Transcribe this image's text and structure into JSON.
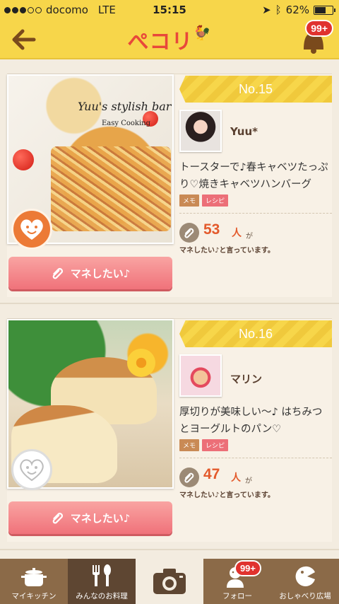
{
  "status_bar": {
    "carrier": "docomo",
    "network": "LTE",
    "time": "15:15",
    "battery": "62%",
    "battery_level": 0.62
  },
  "header": {
    "logo_text": "ぺコリ",
    "notification_badge": "99+"
  },
  "cards": [
    {
      "rank": "No.15",
      "photo_title": "Yuu's stylish bar",
      "photo_subtitle": "Easy Cooking",
      "username": "Yuu*",
      "title": "トースターで♪春キャベツたっぷり♡焼きキャベツハンバーグ",
      "tags": [
        "メモ",
        "レシピ"
      ],
      "like_count": "53",
      "like_unit": "人",
      "like_ga": "が",
      "like_desc": "マネしたい♪と言っています。",
      "button_label": "マネしたい♪"
    },
    {
      "rank": "No.16",
      "username": "マリン",
      "title": "厚切りが美味しい〜♪ はちみつとヨーグルトのパン♡",
      "tags": [
        "メモ",
        "レシピ"
      ],
      "like_count": "47",
      "like_unit": "人",
      "like_ga": "が",
      "like_desc": "マネしたい♪と言っています。",
      "button_label": "マネしたい♪"
    }
  ],
  "tabbar": {
    "items": [
      {
        "label": "マイキッチン",
        "icon": "pot-icon"
      },
      {
        "label": "みんなのお料理",
        "icon": "fork-spoon-icon"
      },
      {
        "label": "",
        "icon": "camera-icon"
      },
      {
        "label": "フォロー",
        "icon": "follow-icon",
        "badge": "99+"
      },
      {
        "label": "おしゃべり広場",
        "icon": "chat-icon"
      }
    ]
  },
  "colors": {
    "header_yellow": "#f7d64a",
    "accent_red": "#e8483a",
    "button_pink": "#f0727a",
    "tabbar_brown": "#8b6a48"
  }
}
